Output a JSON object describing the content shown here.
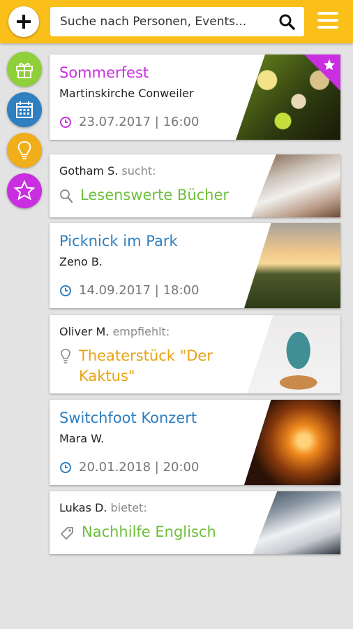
{
  "header": {
    "add_icon": "plus-icon",
    "search_placeholder": "Suche nach Personen, Events...",
    "search_icon": "search-icon",
    "menu_icon": "hamburger-menu-icon"
  },
  "categories": [
    {
      "name": "gift-icon",
      "color": "#8fcf3a"
    },
    {
      "name": "calendar-icon",
      "color": "#2f7fc1"
    },
    {
      "name": "lightbulb-icon",
      "color": "#f0ae1a"
    },
    {
      "name": "star-icon",
      "color": "#c92fe0"
    }
  ],
  "feed": {
    "event1": {
      "title": "Sommerfest",
      "location": "Martinskirche Conweiler",
      "datetime": "23.07.2017 | 16:00",
      "badge": "star-icon"
    },
    "ask1": {
      "user": "Gotham S.",
      "verb": "sucht:",
      "item": "Lesenswerte Bücher"
    },
    "event2": {
      "title": "Picknick im Park",
      "host": "Zeno B.",
      "datetime": "14.09.2017 | 18:00"
    },
    "rec1": {
      "user": "Oliver M.",
      "verb": "empfiehlt:",
      "item": "Theaterstück \"Der Kaktus\""
    },
    "event3": {
      "title": "Switchfoot Konzert",
      "host": "Mara W.",
      "datetime": "20.01.2018 | 20:00"
    },
    "offer1": {
      "user": "Lukas D.",
      "verb": "bietet:",
      "item": "Nachhilfe Englisch"
    }
  }
}
